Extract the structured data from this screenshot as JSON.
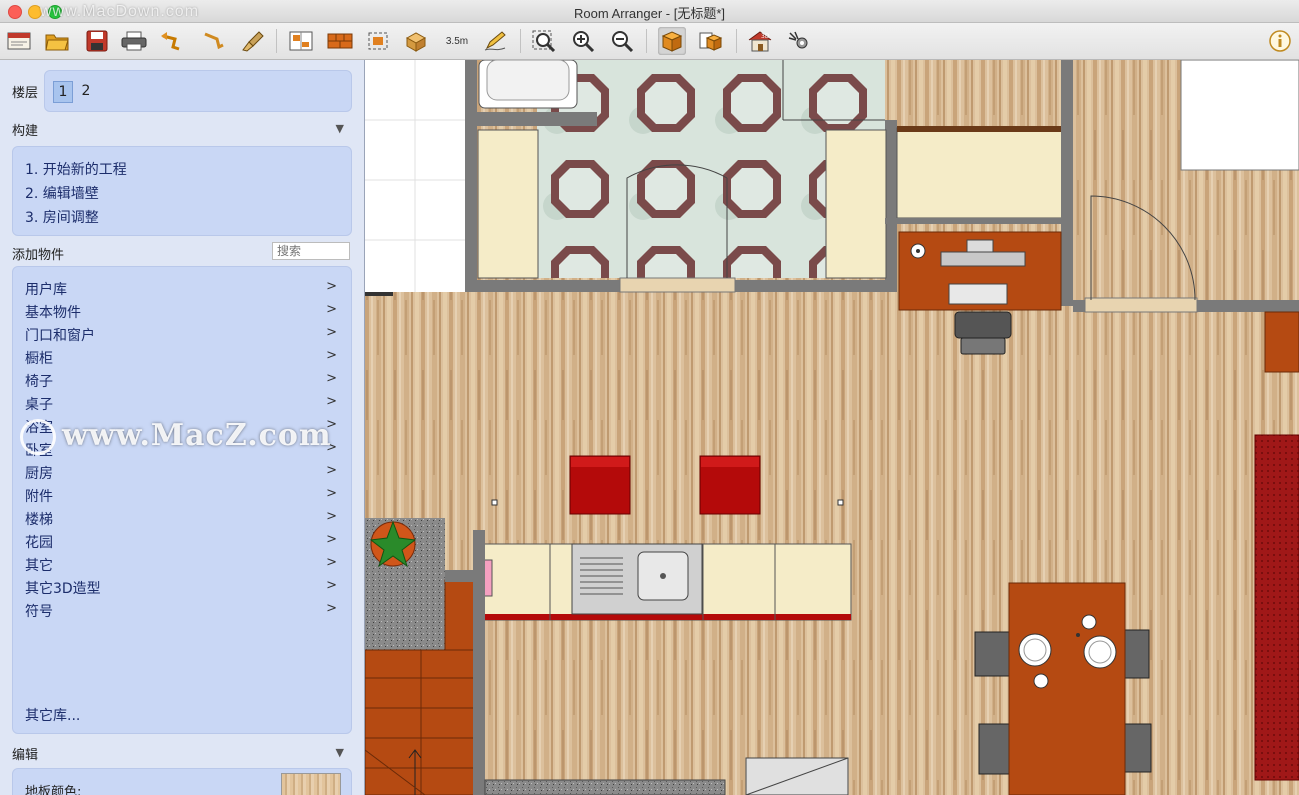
{
  "window": {
    "title": "Room Arranger - [无标题*]",
    "watermark_top": "www.MacDown.com",
    "watermark_mid": "www.MacZ.com"
  },
  "toolbar": {
    "buttons": [
      {
        "name": "new-project-icon"
      },
      {
        "name": "open-folder-icon"
      },
      {
        "name": "save-icon"
      },
      {
        "name": "print-icon"
      },
      {
        "name": "undo-icon"
      },
      {
        "name": "redo-icon"
      },
      {
        "name": "paint-brush-icon"
      },
      {
        "name": "room-properties-icon"
      },
      {
        "name": "wall-icon"
      },
      {
        "name": "select-area-icon"
      },
      {
        "name": "move-object-icon"
      },
      {
        "name": "measure-icon",
        "label": "3.5m"
      },
      {
        "name": "pencil-icon"
      },
      {
        "name": "zoom-fit-icon"
      },
      {
        "name": "zoom-in-icon"
      },
      {
        "name": "zoom-out-icon"
      },
      {
        "name": "3d-box-icon"
      },
      {
        "name": "3d-box-copy-icon"
      },
      {
        "name": "3d-house-icon"
      },
      {
        "name": "settings-gear-icon"
      },
      {
        "name": "info-icon"
      }
    ]
  },
  "sidebar": {
    "floors_label": "楼层",
    "floors": [
      "1",
      "2"
    ],
    "build_label": "构建",
    "build_items": [
      "1. 开始新的工程",
      "2. 编辑墙壁",
      "3. 房间调整"
    ],
    "add_objects_label": "添加物件",
    "search_placeholder": "搜索",
    "categories": [
      "用户库",
      "基本物件",
      "门口和窗户",
      "橱柜",
      "椅子",
      "桌子",
      "浴室",
      "卧室",
      "厨房",
      "附件",
      "楼梯",
      "花园",
      "其它",
      "其它3D造型",
      "符号"
    ],
    "category_arrow": ">",
    "more_libraries": "其它库...",
    "edit_label": "编辑",
    "floor_color_label": "地板颜色:",
    "collapse_glyph": "▼"
  },
  "colors": {
    "wood": "#d9bb95",
    "wall": "#7a7a7a",
    "chair_red": "#b40a0a",
    "furniture_cream": "#f5ecc8",
    "table_brown": "#b54a12",
    "rug_red": "#a01818"
  }
}
